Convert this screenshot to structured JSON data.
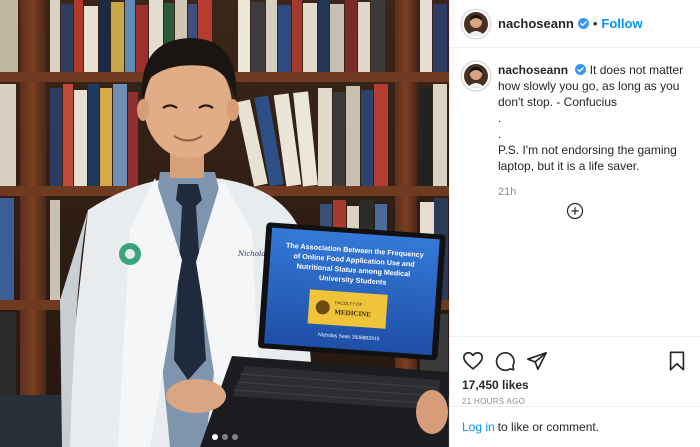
{
  "post": {
    "username": "nachoseann",
    "follow_label": "Follow",
    "separator": "•",
    "caption_lines": [
      "It does not matter",
      "how slowly you go, as long as you",
      "don't stop. - Confucius",
      ".",
      ".",
      "P.S. I'm not endorsing the gaming",
      "laptop, but it is a life saver."
    ],
    "caption_time": "21h",
    "likes": "17,450 likes",
    "posted_ago": "21 HOURS AGO",
    "login_link": "Log in",
    "login_text": "to like or comment.",
    "carousel_count": 3,
    "carousel_active": 1
  },
  "photo": {
    "slide_title_lines": [
      "The Association Between the Frequency",
      "of Online Food Application Use and",
      "Nutritional Status among Medical",
      "University Students"
    ],
    "faculty_label": "FACULTY OF",
    "faculty_name": "MEDICINE",
    "presenter": "Nicholas Sean 1606863915",
    "coat_name": "Nicholas Sean"
  },
  "icons": {
    "like": "heart-icon",
    "comment": "comment-icon",
    "share": "share-icon",
    "save": "bookmark-icon",
    "verified": "verified-badge-icon",
    "more": "add-comment-icon"
  },
  "colors": {
    "accent": "#0095f6",
    "text": "#262626",
    "muted": "#8e8e8e",
    "border": "#efefef",
    "slide_blue": "#2a63c4"
  }
}
